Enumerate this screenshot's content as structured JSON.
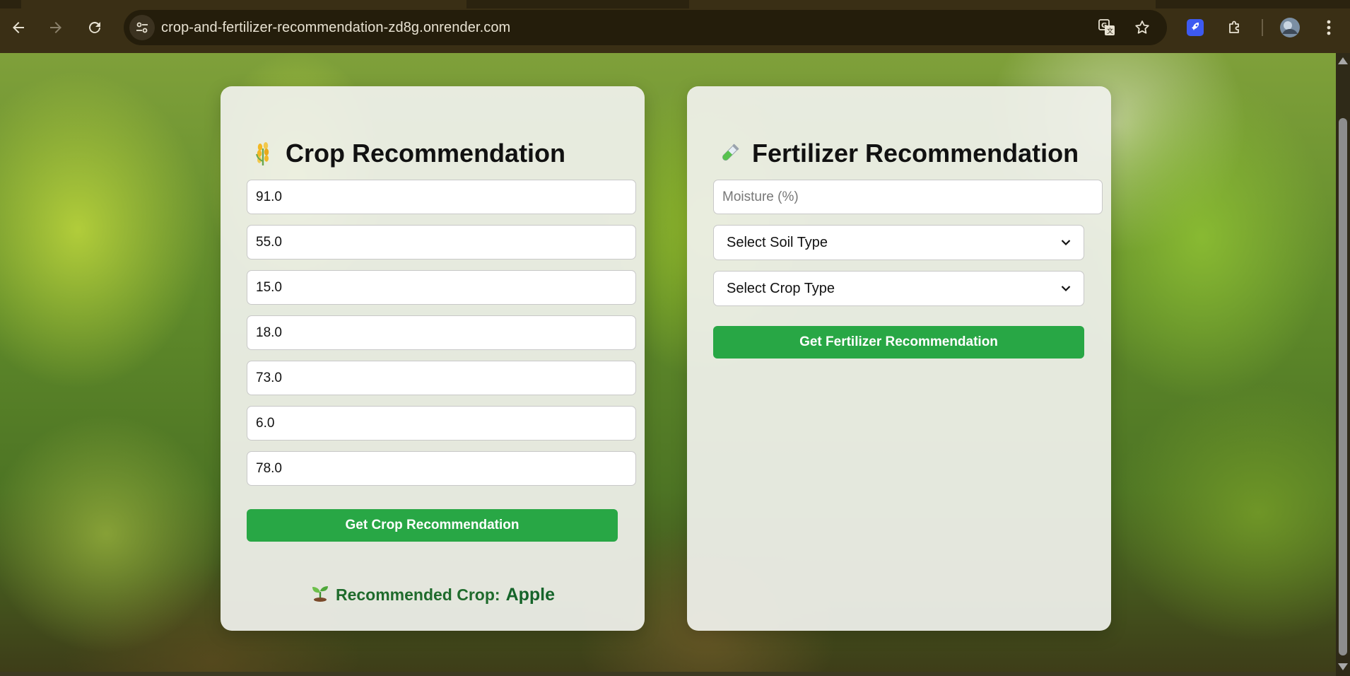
{
  "browser": {
    "url": "crop-and-fertilizer-recommendation-zd8g.onrender.com",
    "icons": {
      "back": "arrow-left-icon",
      "forward": "arrow-right-icon",
      "reload": "reload-icon",
      "site_info": "tune-icon",
      "translate": "translate-icon",
      "bookmark": "star-icon",
      "extension_app": "rocket-extension-icon",
      "extensions": "puzzle-icon",
      "profile": "avatar-icon",
      "menu": "kebab-menu-icon"
    }
  },
  "crop_card": {
    "title": "Crop Recommendation",
    "title_icon": "wheat-icon",
    "inputs": [
      {
        "value": "91.0"
      },
      {
        "value": "55.0"
      },
      {
        "value": "15.0"
      },
      {
        "value": "18.0"
      },
      {
        "value": "73.0"
      },
      {
        "value": "6.0"
      },
      {
        "value": "78.0"
      }
    ],
    "button_label": "Get Crop Recommendation",
    "result_label": "Recommended Crop:",
    "result_value": "Apple",
    "result_icon": "seedling-icon"
  },
  "fertilizer_card": {
    "title": "Fertilizer Recommendation",
    "title_icon": "test-tube-icon",
    "moisture_placeholder": "Moisture (%)",
    "soil_select": "Select Soil Type",
    "crop_select": "Select Crop Type",
    "button_label": "Get Fertilizer Recommendation"
  },
  "colors": {
    "button_green": "#28a745",
    "result_green": "#1f6b2c",
    "chrome_bg": "#3a2f15"
  }
}
